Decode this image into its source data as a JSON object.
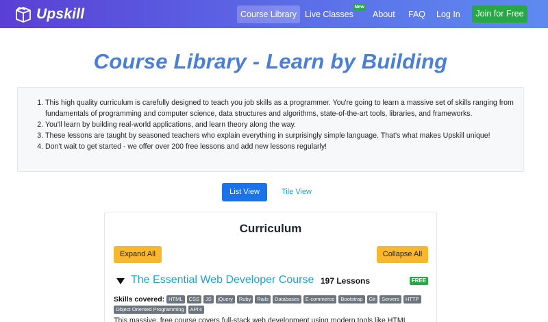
{
  "navbar": {
    "brand": "Upskill",
    "links": [
      {
        "label": "Course Library",
        "active": true
      },
      {
        "label": "Live Classes",
        "badge": "New"
      },
      {
        "label": "About"
      },
      {
        "label": "FAQ"
      },
      {
        "label": "Log In"
      }
    ],
    "cta": "Join for Free"
  },
  "page_title": "Course Library - Learn by Building",
  "intro_points": [
    "This high quality curriculum is carefully designed to teach you job skills as a programmer. You're going to learn a massive set of skills ranging from fundamentals of programming and computer science, data structures and algorithms, state-of-the-art tools, libraries, and frameworks.",
    "You'll learn by building real-world applications, and learn theory along the way.",
    "These lessons are taught by seasoned teachers who explain everything in surprisingly simple language. That's what makes Upskill unique!",
    "Don't wait to get started - we offer over 200 free lessons and add new lessons regularly!"
  ],
  "view_toggle": {
    "list": "List View",
    "tile": "Tile View",
    "selected": "list"
  },
  "curriculum": {
    "title": "Curriculum",
    "expand_all": "Expand All",
    "collapse_all": "Collapse All",
    "course": {
      "title": "The Essential Web Developer Course",
      "lessons": "197 Lessons",
      "price_badge": "FREE",
      "skills_label": "Skills covered:",
      "skills": [
        "HTML",
        "CSS",
        "JS",
        "jQuery",
        "Ruby",
        "Rails",
        "Databases",
        "E-commerce",
        "Bootstrap",
        "Git",
        "Servers",
        "HTTP",
        "Object Oriented Programming",
        "API's"
      ],
      "description": "This massive, free course covers full-stack web development using modern tools like HTML"
    }
  },
  "colors": {
    "nav_gradient_start": "#5a3fd4",
    "nav_gradient_end": "#5e8af0",
    "title_blue": "#4a7fd6",
    "green": "#28a745",
    "primary_blue": "#1a73e8",
    "link_cyan": "#17a2c8",
    "yellow": "#f9b72b",
    "tag_gray": "#6c757d"
  },
  "icons": {
    "brand": "open-box-icon",
    "course_toggle": "caret-down-icon"
  }
}
